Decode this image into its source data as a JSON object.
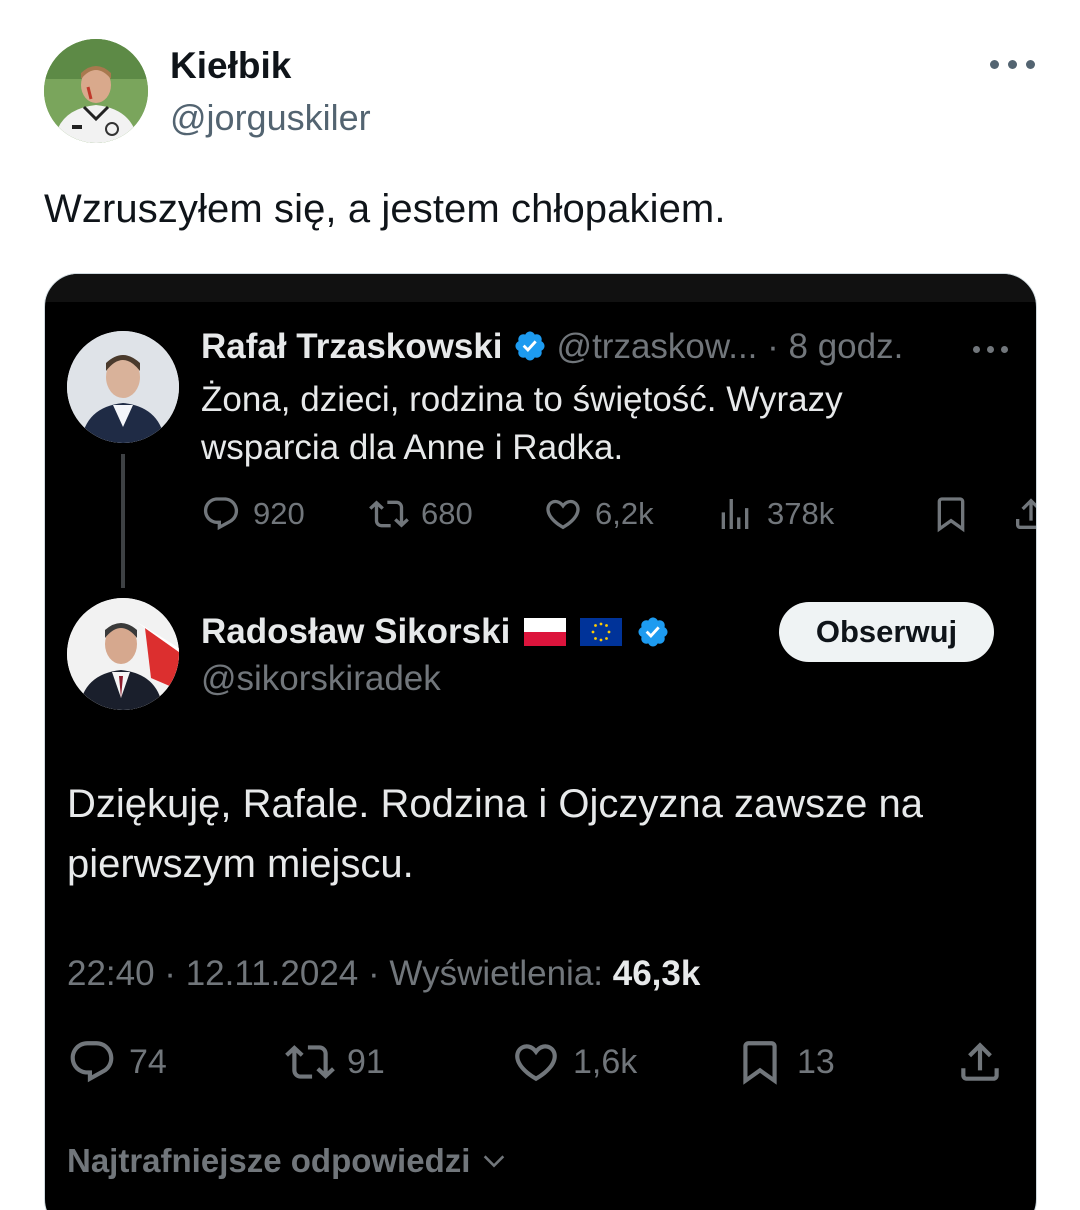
{
  "post": {
    "author_name": "Kiełbik",
    "author_handle": "@jorguskiler",
    "text": "Wzruszyłem się, a jestem chłopakiem.",
    "more_icon": "more-horizontal-icon"
  },
  "embedded": {
    "parent": {
      "author_name": "Rafał Trzaskowski",
      "verified": true,
      "handle_time": "@trzaskow... · 8 godz.",
      "text": "Żona, dzieci, rodzina to świętość. Wyrazy wsparcia dla Anne i Radka.",
      "stats": {
        "replies": "920",
        "reposts": "680",
        "likes": "6,2k",
        "views": "378k"
      }
    },
    "reply": {
      "author_name": "Radosław Sikorski",
      "flags": [
        "flag-poland-icon",
        "flag-eu-icon"
      ],
      "verified": true,
      "handle": "@sikorskiradek",
      "follow_label": "Obserwuj",
      "text": "Dziękuję, Rafale. Rodzina i Ojczyzna zawsze na pierwszym miejscu.",
      "time": "22:40 · 12.11.2024 · Wyświetlenia:",
      "views": "46,3k",
      "stats": {
        "replies": "74",
        "reposts": "91",
        "likes": "1,6k",
        "bookmarks": "13"
      },
      "replies_sort_label": "Najtrafniejsze odpowiedzi"
    }
  },
  "colors": {
    "verified_blue": "#1d9bf0",
    "dark_bg": "#000000",
    "dark_text": "#e7e9ea",
    "dark_muted": "#71767b",
    "light_muted": "#536471"
  }
}
